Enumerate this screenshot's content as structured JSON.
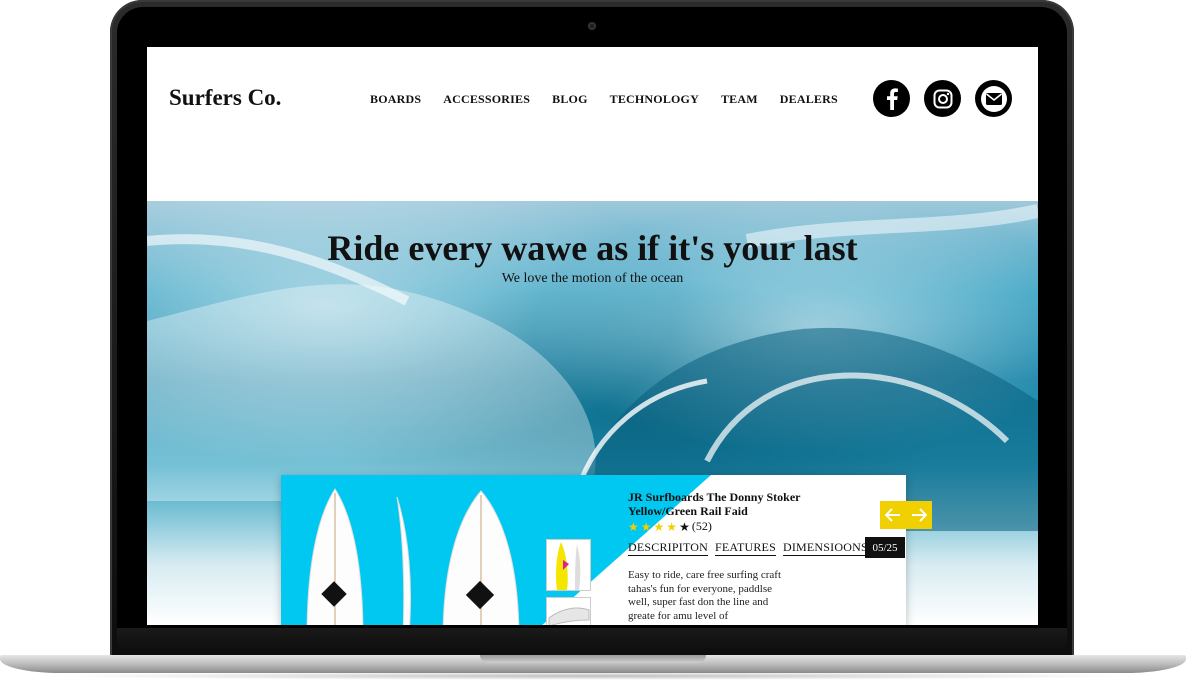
{
  "header": {
    "logo": "Surfers Co.",
    "nav": [
      "BOARDS",
      "ACCESSORIES",
      "BLOG",
      "TECHNOLOGY",
      "TEAM",
      "DEALERS"
    ],
    "socials": [
      "facebook-icon",
      "instagram-icon",
      "envelope-icon"
    ]
  },
  "hero": {
    "title": "Ride every wawe as if it's your last",
    "subtitle": "We love the motion of the ocean"
  },
  "product": {
    "title": "JR Surfboards The Donny Stoker Yellow/Green Rail Faid",
    "rating": 4,
    "rating_max": 5,
    "reviews": "(52)",
    "tabs": [
      "DESCRIPITON",
      "FEATURES",
      "DIMENSIOONS"
    ],
    "counter": "05/25",
    "description": "Easy to ride, care free surfing craft tahas's fun for everyone, paddlse well, super fast don the line and greate for amu level of",
    "accent_color": "#00c8f0",
    "star_color": "#f0d000"
  },
  "slider": {
    "prev_icon": "arrow-left-icon",
    "next_icon": "arrow-right-icon",
    "color": "#f0d000"
  }
}
